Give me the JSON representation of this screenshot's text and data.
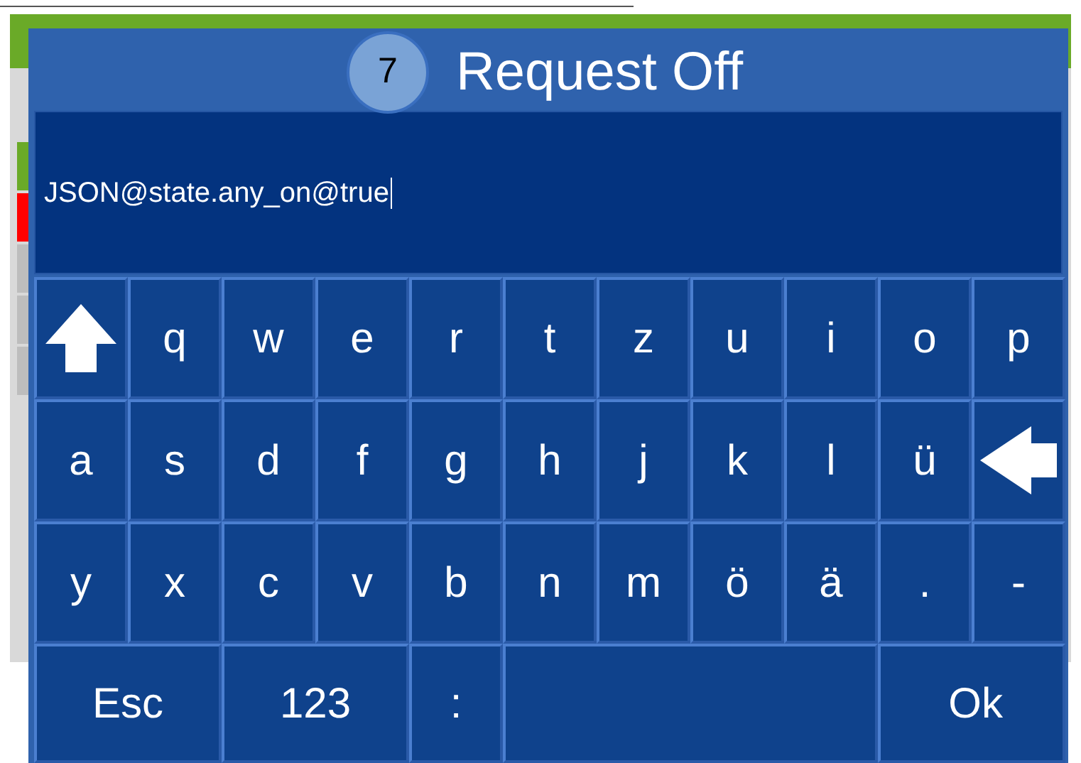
{
  "background": {
    "indicators": [
      {
        "color": "#6aaa28"
      },
      {
        "color": "#ff0000"
      },
      {
        "color": "#bdbdbd"
      },
      {
        "color": "#bdbdbd"
      },
      {
        "color": "#bdbdbd"
      }
    ]
  },
  "dialog": {
    "badge": "7",
    "title": "Request Off",
    "input": {
      "value": "JSON@state.any_on@true",
      "focused": true
    },
    "keys": [
      [
        {
          "kind": "shift"
        },
        {
          "kind": "key",
          "label": "q"
        },
        {
          "kind": "key",
          "label": "w"
        },
        {
          "kind": "key",
          "label": "e"
        },
        {
          "kind": "key",
          "label": "r"
        },
        {
          "kind": "key",
          "label": "t"
        },
        {
          "kind": "key",
          "label": "z"
        },
        {
          "kind": "key",
          "label": "u"
        },
        {
          "kind": "key",
          "label": "i"
        },
        {
          "kind": "key",
          "label": "o"
        },
        {
          "kind": "key",
          "label": "p"
        }
      ],
      [
        {
          "kind": "key",
          "label": "a"
        },
        {
          "kind": "key",
          "label": "s"
        },
        {
          "kind": "key",
          "label": "d"
        },
        {
          "kind": "key",
          "label": "f"
        },
        {
          "kind": "key",
          "label": "g"
        },
        {
          "kind": "key",
          "label": "h"
        },
        {
          "kind": "key",
          "label": "j"
        },
        {
          "kind": "key",
          "label": "k"
        },
        {
          "kind": "key",
          "label": "l"
        },
        {
          "kind": "key",
          "label": "ü"
        },
        {
          "kind": "backspace"
        }
      ],
      [
        {
          "kind": "key",
          "label": "y"
        },
        {
          "kind": "key",
          "label": "x"
        },
        {
          "kind": "key",
          "label": "c"
        },
        {
          "kind": "key",
          "label": "v"
        },
        {
          "kind": "key",
          "label": "b"
        },
        {
          "kind": "key",
          "label": "n"
        },
        {
          "kind": "key",
          "label": "m"
        },
        {
          "kind": "key",
          "label": "ö"
        },
        {
          "kind": "key",
          "label": "ä"
        },
        {
          "kind": "key",
          "label": "."
        },
        {
          "kind": "key",
          "label": "-"
        }
      ],
      [
        {
          "kind": "wide",
          "label": "Esc"
        },
        {
          "kind": "wide",
          "label": "123"
        },
        {
          "kind": "key",
          "label": ":"
        },
        {
          "kind": "space"
        },
        {
          "kind": "wide",
          "label": "Ok",
          "label_right": true
        }
      ]
    ]
  }
}
